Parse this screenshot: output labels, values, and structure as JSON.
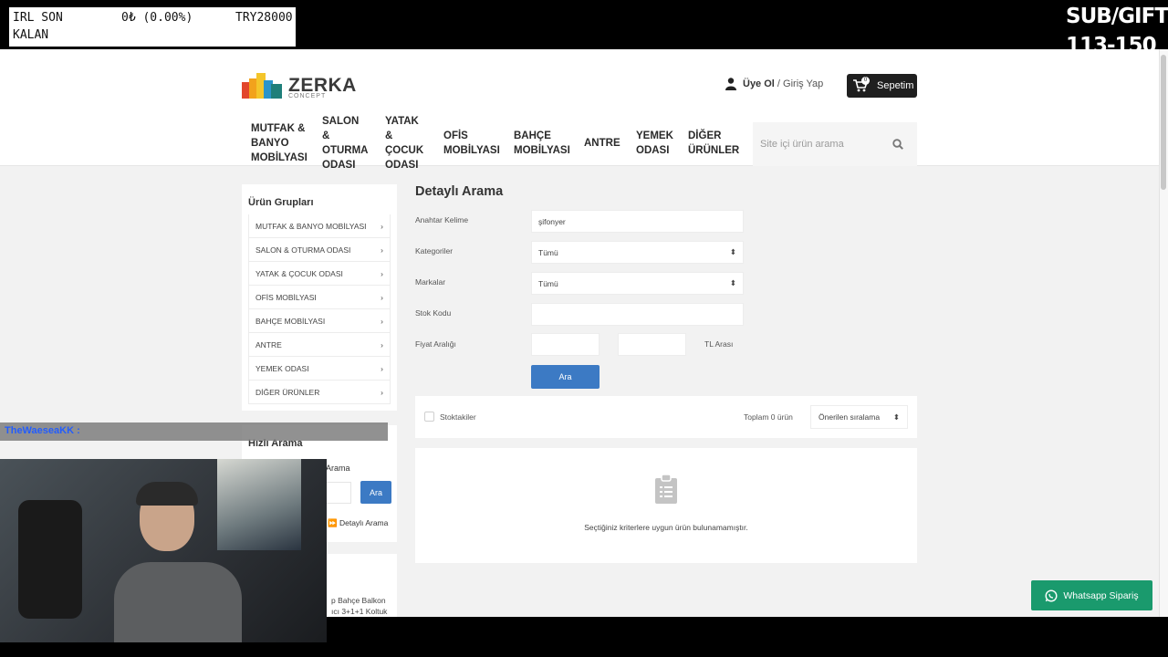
{
  "overlay": {
    "stat_label_1": "IRL SON",
    "stat_label_2": "KALAN",
    "stat_change": "0₺ (0.00%)",
    "stat_goal": "TRY28000",
    "sub_gift_line1": "SUB/GIFT",
    "sub_gift_line2": "113-150",
    "chat_username": "TheWaeseaKK :"
  },
  "site": {
    "logo_text": "ZERKA",
    "logo_sub": "CONCEPT",
    "register_label": "Üye Ol",
    "login_label": "/ Giriş Yap",
    "cart_label": "Sepetim",
    "cart_count": "0",
    "search_placeholder": "Site içi ürün arama",
    "nav": [
      "MUTFAK & BANYO MOBİLYASI",
      "SALON & OTURMA ODASI",
      "YATAK & ÇOCUK ODASI",
      "OFİS MOBİLYASI",
      "BAHÇE MOBİLYASI",
      "ANTRE",
      "YEMEK ODASI",
      "DİĞER ÜRÜNLER"
    ]
  },
  "sidebar": {
    "title": "Ürün Grupları",
    "items": [
      "MUTFAK & BANYO MOBİLYASI",
      "SALON & OTURMA ODASI",
      "YATAK & ÇOCUK ODASI",
      "OFİS MOBİLYASI",
      "BAHÇE MOBİLYASI",
      "ANTRE",
      "YEMEK ODASI",
      "DİĞER ÜRÜNLER"
    ],
    "quick_title": "Hızlı Arama",
    "quick_label": "Arama",
    "quick_button": "Ara",
    "quick_adv": "Detaylı Arama",
    "third_line1": "p Bahçe Balkon",
    "third_line2": "ıcı 3+1+1 Koltuk"
  },
  "search_form": {
    "title": "Detaylı Arama",
    "keyword_label": "Anahtar Kelime",
    "keyword_value": "şifonyer",
    "category_label": "Kategoriler",
    "category_value": "Tümü",
    "brand_label": "Markalar",
    "brand_value": "Tümü",
    "stock_code_label": "Stok Kodu",
    "price_label": "Fiyat Aralığı",
    "price_unit": "TL Arası",
    "submit": "Ara"
  },
  "results": {
    "in_stock_label": "Stoktakiler",
    "total": "Toplam 0 ürün",
    "sort_value": "Önerilen sıralama",
    "empty_message": "Seçtiğiniz kriterlere uygun ürün bulunamamıştır."
  },
  "whatsapp_label": "Whatsapp Sipariş",
  "colors": {
    "primary_button": "#3c7ac4",
    "whatsapp": "#1a9a6d",
    "cart": "#1f1f1f"
  }
}
